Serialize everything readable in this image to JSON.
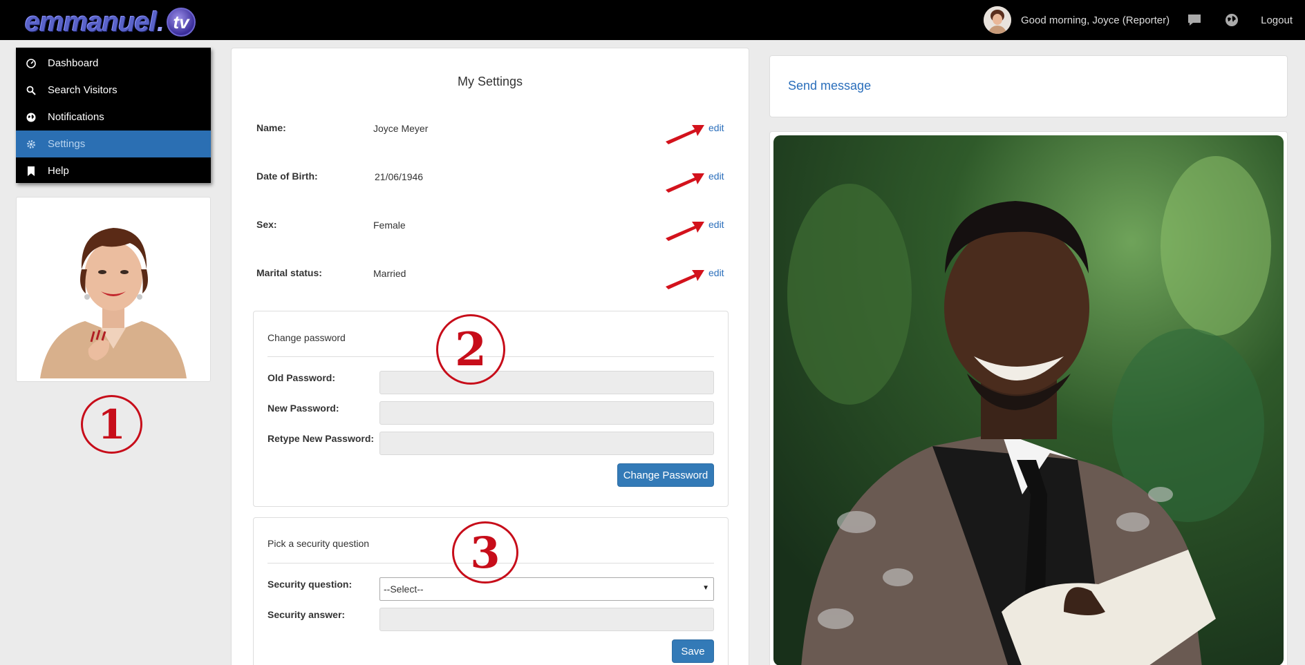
{
  "header": {
    "logo_text": "emmanuel",
    "logo_dot": ".",
    "logo_tv": "tv",
    "greeting": "Good morning, Joyce (Reporter)",
    "chat_icon": "chat-bubble-icon",
    "globe_icon": "globe-icon",
    "logout_label": "Logout"
  },
  "sidebar": {
    "items": [
      {
        "label": "Dashboard",
        "icon": "dashboard-icon",
        "active": false
      },
      {
        "label": "Search Visitors",
        "icon": "search-icon",
        "active": false
      },
      {
        "label": "Notifications",
        "icon": "globe-icon",
        "active": false
      },
      {
        "label": "Settings",
        "icon": "gear-icon",
        "active": true
      },
      {
        "label": "Help",
        "icon": "bookmark-icon",
        "active": false
      }
    ]
  },
  "annotations": [
    "1",
    "2",
    "3"
  ],
  "settings": {
    "title": "My Settings",
    "rows": [
      {
        "label": "Name:",
        "value": "Joyce  Meyer",
        "action": "edit"
      },
      {
        "label": "Date of Birth:",
        "value": "21/06/1946",
        "action": "edit"
      },
      {
        "label": "Sex:",
        "value": "Female",
        "action": "edit"
      },
      {
        "label": "Marital status:",
        "value": "Married",
        "action": "edit"
      }
    ],
    "password": {
      "title": "Change password",
      "old_label": "Old Password:",
      "new_label": "New Password:",
      "retype_label": "Retype New Password:",
      "old_value": "",
      "new_value": "",
      "retype_value": "",
      "button": "Change Password"
    },
    "security": {
      "title": "Pick a security question",
      "question_label": "Security question:",
      "question_selected": "--Select--",
      "answer_label": "Security answer:",
      "answer_value": "",
      "button": "Save"
    }
  },
  "right": {
    "send_message": "Send message"
  },
  "colors": {
    "accent": "#337ab7",
    "link": "#2a6ebb",
    "annotation": "#c70d1a",
    "topbar": "#000000"
  }
}
